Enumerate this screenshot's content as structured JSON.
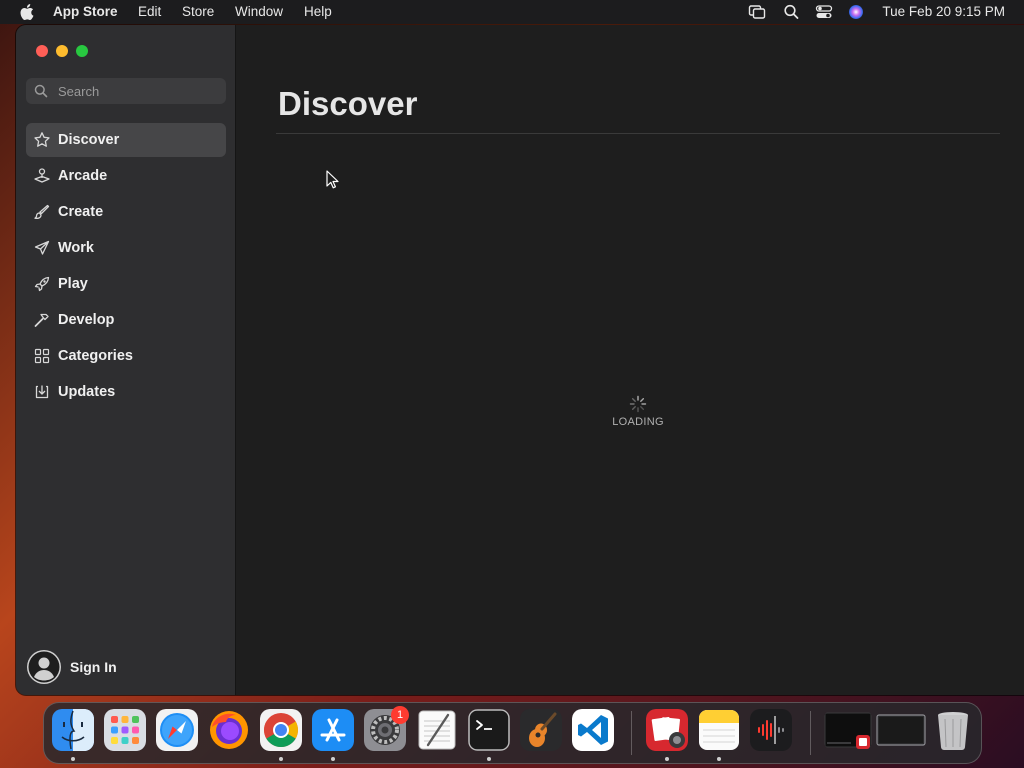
{
  "menubar": {
    "app_name": "App Store",
    "menus": [
      "Edit",
      "Store",
      "Window",
      "Help"
    ],
    "clock": "Tue Feb 20  9:15 PM"
  },
  "sidebar": {
    "search_placeholder": "Search",
    "items": [
      {
        "label": "Discover",
        "icon": "star-icon",
        "selected": true
      },
      {
        "label": "Arcade",
        "icon": "joystick-icon"
      },
      {
        "label": "Create",
        "icon": "brush-icon"
      },
      {
        "label": "Work",
        "icon": "paper-plane-icon"
      },
      {
        "label": "Play",
        "icon": "rocket-icon"
      },
      {
        "label": "Develop",
        "icon": "hammer-icon"
      },
      {
        "label": "Categories",
        "icon": "grid-icon"
      },
      {
        "label": "Updates",
        "icon": "download-icon"
      }
    ],
    "sign_in": "Sign In"
  },
  "main": {
    "title": "Discover",
    "loading_text": "LOADING"
  },
  "dock": {
    "badge_count": "1",
    "apps": [
      "Finder",
      "Launchpad",
      "Safari",
      "Firefox",
      "Chrome",
      "App Store",
      "System Settings",
      "TextEdit",
      "Terminal",
      "GarageBand",
      "Visual Studio Code",
      "Photo Booth",
      "Notes",
      "Voice Memos"
    ]
  },
  "colors": {
    "sidebar_bg": "#2e2e30",
    "main_bg": "#1e1e1e",
    "selected_item": "#464648",
    "close": "#ff5f57",
    "minimize": "#febc2e",
    "zoom": "#28c840"
  }
}
